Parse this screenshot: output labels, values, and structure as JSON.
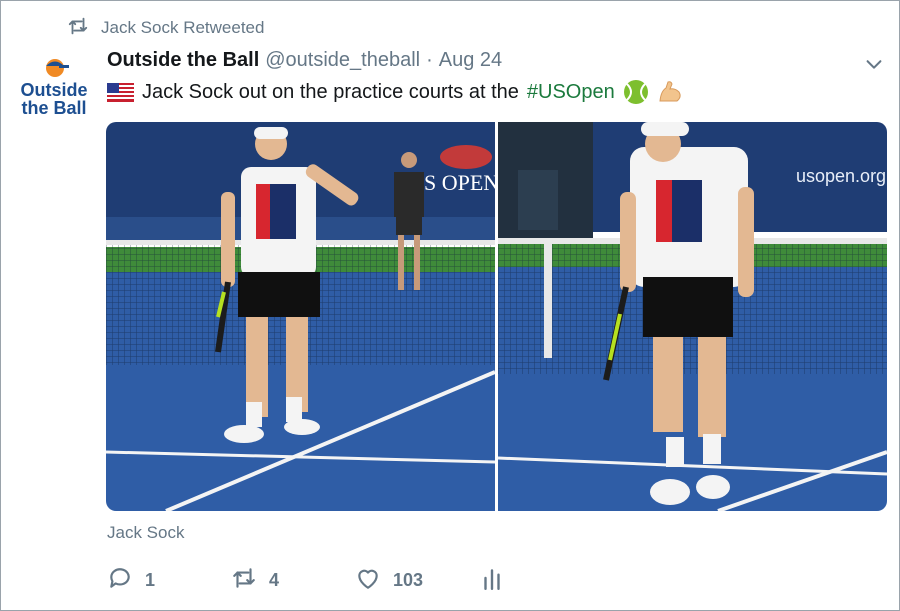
{
  "retweet": {
    "icon": "retweet-icon",
    "label": "Jack Sock Retweeted"
  },
  "author": {
    "avatar_lines": [
      "Outside",
      "the Ball"
    ],
    "name": "Outside the Ball",
    "handle": "@outside_theball",
    "separator": "·",
    "date": "Aug 24"
  },
  "tweet": {
    "flag_icon": "us-flag-icon",
    "text_prefix": "Jack Sock out on the practice courts at the",
    "hashtag": "#USOpen",
    "emoji_icons": [
      "tennis-ball-icon",
      "flexed-biceps-icon"
    ]
  },
  "photos": [
    {
      "name": "photo-left",
      "banner_text": "S OPEN"
    },
    {
      "name": "photo-right",
      "banner_text": "usopen.org"
    }
  ],
  "tagged_user": "Jack Sock",
  "actions": {
    "reply_count": "1",
    "retweet_count": "4",
    "like_count": "103"
  },
  "colors": {
    "hashtag": "#1b7a3d",
    "muted": "#657786",
    "court": "#2f5da6",
    "wall": "#1f3d74"
  }
}
